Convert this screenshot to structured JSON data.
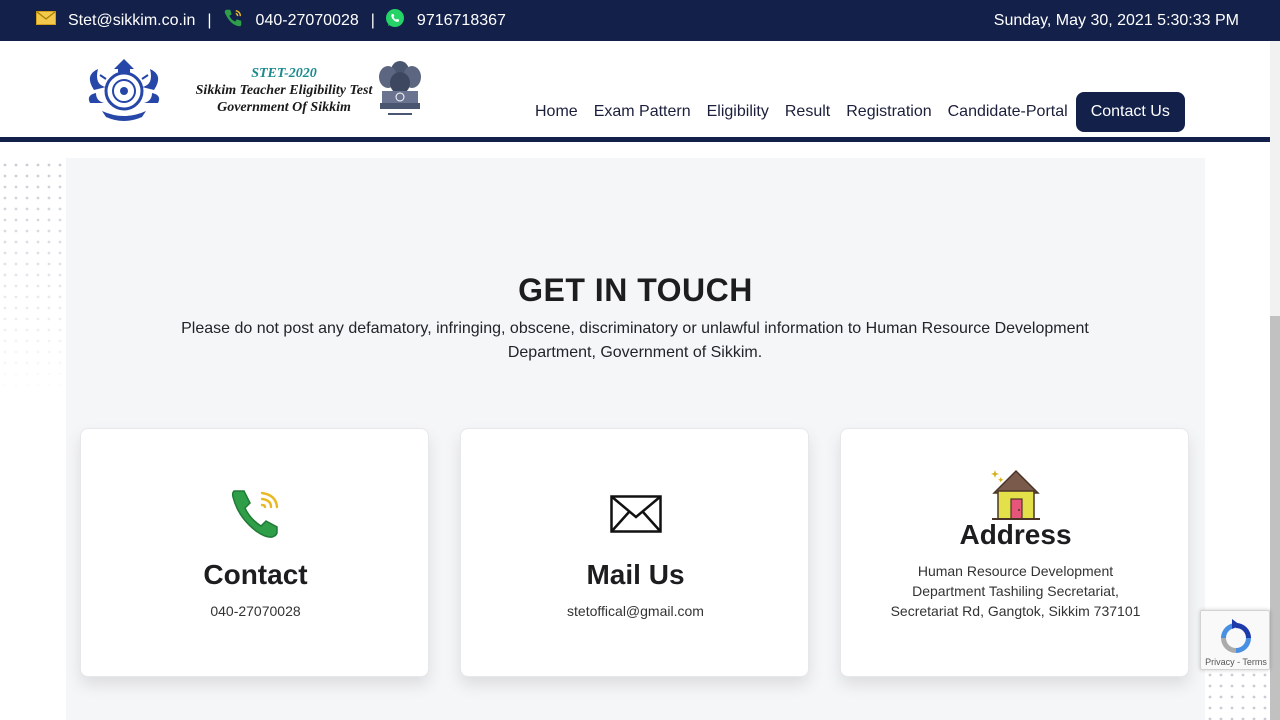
{
  "topbar": {
    "email": "Stet@sikkim.co.in",
    "separator": "|",
    "phone": "040-27070028",
    "whatsapp": "9716718367",
    "datetime": "Sunday, May 30, 2021 5:30:33 PM",
    "icons": [
      "mail-icon",
      "phone-icon",
      "whatsapp-icon"
    ]
  },
  "logo": {
    "line1": "STET-2020",
    "line2": "Sikkim Teacher Eligibility Test",
    "line3": "Government Of Sikkim"
  },
  "nav": {
    "items": [
      "Home",
      "Exam Pattern",
      "Eligibility",
      "Result",
      "Registration",
      "Candidate-Portal",
      "Contact Us"
    ],
    "active": "Contact Us"
  },
  "main": {
    "heading": "GET IN TOUCH",
    "subtext": "Please do not post any defamatory, infringing, obscene, discriminatory or unlawful information to Human Resource Development Department, Government of Sikkim.",
    "cards": [
      {
        "icon": "phone-icon",
        "title": "Contact",
        "detail": "040-27070028"
      },
      {
        "icon": "envelope-icon",
        "title": "Mail Us",
        "detail": "stetoffical@gmail.com"
      },
      {
        "icon": "house-icon",
        "title": "Address",
        "detail": "Human Resource Development Department Tashiling Secretariat, Secretariat Rd, Gangtok, Sikkim 737101"
      }
    ]
  },
  "recaptcha": {
    "links": "Privacy - Terms"
  },
  "colors": {
    "navy": "#13204a",
    "section_bg": "#f5f6f8",
    "logo_accent": "#1a8a8e"
  }
}
